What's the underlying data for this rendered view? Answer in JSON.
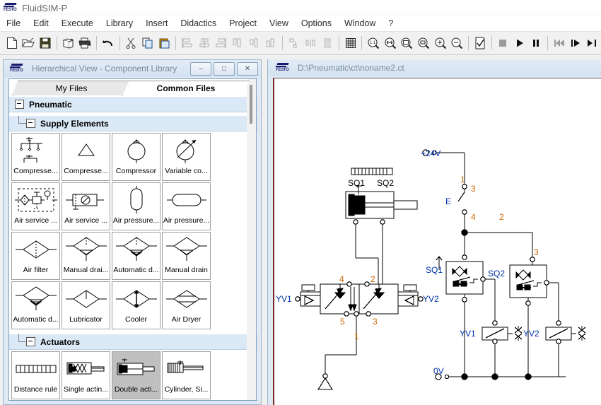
{
  "window": {
    "app_title": "FluidSIM-P",
    "logo_text": "FESTO"
  },
  "menu": {
    "items": [
      {
        "label": "File"
      },
      {
        "label": "Edit"
      },
      {
        "label": "Execute"
      },
      {
        "label": "Library"
      },
      {
        "label": "Insert"
      },
      {
        "label": "Didactics"
      },
      {
        "label": "Project"
      },
      {
        "label": "View"
      },
      {
        "label": "Options"
      },
      {
        "label": "Window"
      },
      {
        "label": "?"
      }
    ]
  },
  "toolbar": {
    "buttons": [
      {
        "name": "new-icon"
      },
      {
        "name": "open-icon"
      },
      {
        "name": "save-icon"
      },
      {
        "name": "print-preview-icon"
      },
      {
        "name": "print-icon"
      },
      {
        "name": "undo-icon"
      },
      {
        "name": "cut-icon"
      },
      {
        "name": "copy-icon"
      },
      {
        "name": "paste-icon"
      },
      {
        "name": "align-left-icon"
      },
      {
        "name": "align-center-icon"
      },
      {
        "name": "align-right-icon"
      },
      {
        "name": "align-top-icon"
      },
      {
        "name": "align-middle-icon"
      },
      {
        "name": "align-bottom-icon"
      },
      {
        "name": "rotate-icon"
      },
      {
        "name": "distribute-horizontal-icon"
      },
      {
        "name": "distribute-vertical-icon"
      },
      {
        "name": "grid-icon"
      },
      {
        "name": "zoom-actual-icon"
      },
      {
        "name": "zoom-fit-width-icon"
      },
      {
        "name": "zoom-fit-page-icon"
      },
      {
        "name": "zoom-area-icon"
      },
      {
        "name": "zoom-in-icon"
      },
      {
        "name": "zoom-out-icon"
      },
      {
        "name": "check-icon"
      },
      {
        "name": "stop-icon"
      },
      {
        "name": "play-icon"
      },
      {
        "name": "pause-icon"
      },
      {
        "name": "rewind-icon"
      },
      {
        "name": "step-icon"
      },
      {
        "name": "forward-end-icon"
      }
    ]
  },
  "library_window": {
    "title": "Hierarchical View - Component Library",
    "minimize_label": "–",
    "restore_label": "□",
    "close_label": "✕",
    "tabs": [
      {
        "label": "My Files",
        "active": false
      },
      {
        "label": "Common Files",
        "active": true
      }
    ],
    "groups": [
      {
        "label": "Pneumatic",
        "level": 1
      },
      {
        "label": "Supply Elements",
        "level": 2
      },
      {
        "label": "Actuators",
        "level": 2
      }
    ],
    "supply_elements": [
      {
        "label": "Compresse...",
        "icon": "compressed-air-supply-multi-icon",
        "selected": false
      },
      {
        "label": "Compresse...",
        "icon": "compressed-air-supply-triangle-icon",
        "selected": false
      },
      {
        "label": "Compressor",
        "icon": "compressor-icon",
        "selected": false
      },
      {
        "label": "Variable co...",
        "icon": "variable-compressor-icon",
        "selected": false
      },
      {
        "label": "Air service ...",
        "icon": "air-service-unit-detailed-icon",
        "selected": false
      },
      {
        "label": "Air service ...",
        "icon": "air-service-unit-simple-icon",
        "selected": false
      },
      {
        "label": "Air pressure...",
        "icon": "air-reservoir-vertical-icon",
        "selected": false
      },
      {
        "label": "Air pressure...",
        "icon": "air-reservoir-horizontal-icon",
        "selected": false
      },
      {
        "label": "Air filter",
        "icon": "air-filter-icon",
        "selected": false
      },
      {
        "label": "Manual drai...",
        "icon": "manual-drain-filter-icon",
        "selected": false
      },
      {
        "label": "Automatic d...",
        "icon": "automatic-drain-filter-icon",
        "selected": false
      },
      {
        "label": "Manual drain",
        "icon": "manual-drain-icon",
        "selected": false
      },
      {
        "label": "Automatic d...",
        "icon": "automatic-drain-icon",
        "selected": false
      },
      {
        "label": "Lubricator",
        "icon": "lubricator-icon",
        "selected": false
      },
      {
        "label": "Cooler",
        "icon": "cooler-icon",
        "selected": false
      },
      {
        "label": "Air Dryer",
        "icon": "air-dryer-icon",
        "selected": false
      }
    ],
    "actuators": [
      {
        "label": "Distance rule",
        "icon": "distance-rule-icon",
        "selected": false
      },
      {
        "label": "Single actin...",
        "icon": "single-acting-cylinder-icon",
        "selected": false
      },
      {
        "label": "Double acti...",
        "icon": "double-acting-cylinder-icon",
        "selected": true
      },
      {
        "label": "Cylinder, Si...",
        "icon": "cylinder-single-icon",
        "selected": false
      }
    ]
  },
  "drawing_window": {
    "title": "D:\\Pneumatic\\ct\\noname2.ct",
    "circuit": {
      "pneumatic": {
        "cylinder_label": "double-acting-cylinder",
        "sensors": [
          "SQ1",
          "SQ2"
        ],
        "valve": {
          "left_solenoid": "YV1",
          "right_solenoid": "YV2",
          "ports": [
            "4",
            "2",
            "5",
            "3",
            "1"
          ]
        },
        "exhaust": "air-supply-triangle"
      },
      "electrical": {
        "supply_top": "+24V",
        "supply_bottom": "0V",
        "switch_label": "E",
        "wire_numbers": [
          "1",
          "3",
          "4",
          "2",
          "3"
        ],
        "sensor_blocks": [
          "SQ1",
          "SQ2"
        ],
        "coils": [
          "YV1",
          "YV2"
        ]
      }
    }
  },
  "colors": {
    "label_blue": "#0033aa",
    "label_orange": "#cc6600",
    "window_frame": "#9db4cc",
    "tab_active_bg": "#ffffff",
    "selection_gray": "#c0c0c0",
    "group_header_bg": "#dbe9f7"
  }
}
